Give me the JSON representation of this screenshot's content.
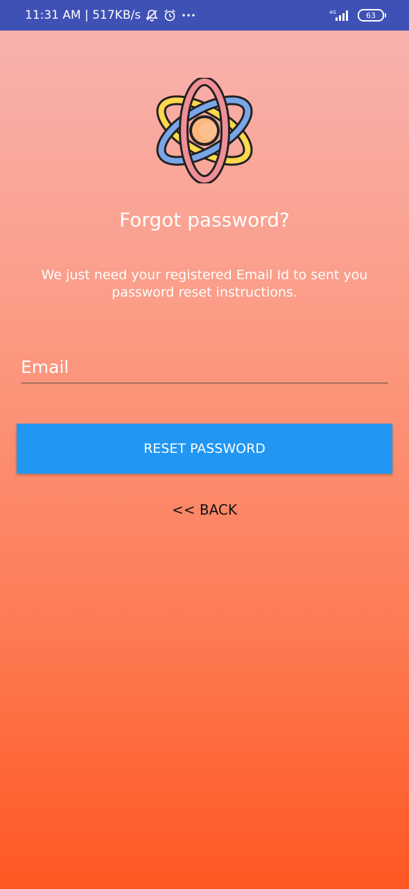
{
  "status_bar": {
    "time_speed": "11:31 AM | 517KB/s",
    "network": "4G",
    "battery": "63",
    "icons": [
      "bell-off-icon",
      "alarm-icon",
      "more-dots-icon",
      "signal-icon",
      "battery-icon"
    ]
  },
  "logo": {
    "icon": "atom-icon"
  },
  "title": "Forgot password?",
  "description": "We just need your registered Email Id to sent you password reset instructions.",
  "email": {
    "placeholder": "Email",
    "value": ""
  },
  "reset_button": {
    "label": "RESET PASSWORD",
    "color": "#2196f3"
  },
  "back_link": {
    "label": "<< BACK"
  },
  "colors": {
    "status_bar": "#3f51b5",
    "gradient_top": "#f8b4b2",
    "gradient_bottom": "#ff5722"
  }
}
